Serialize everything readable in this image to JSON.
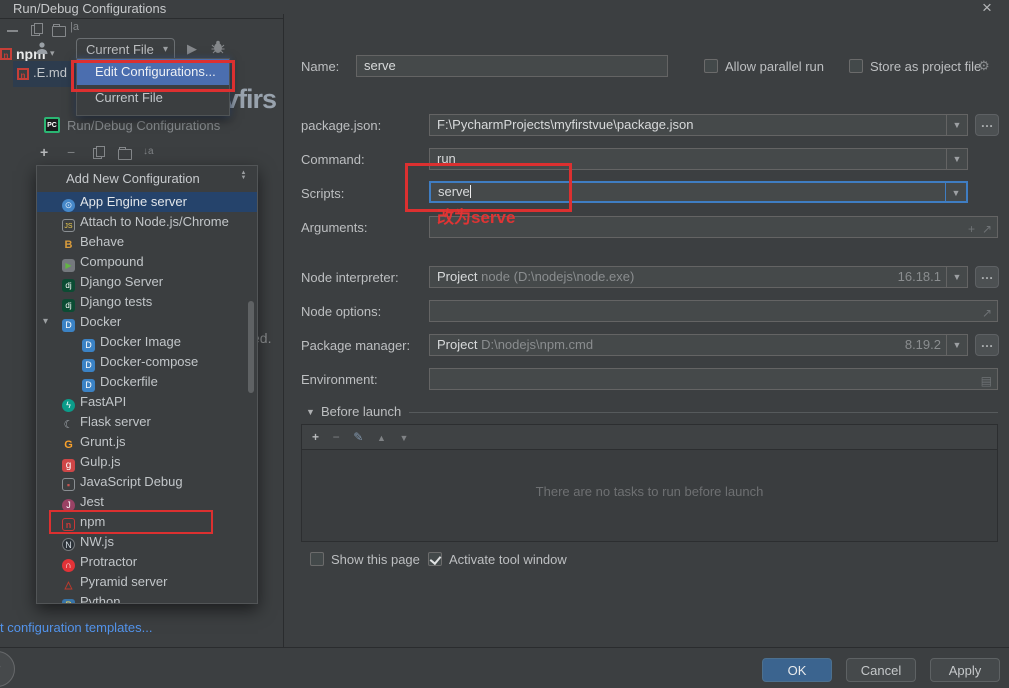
{
  "window": {
    "title": "Run/Debug Configurations",
    "close_glyph": "×"
  },
  "background": {
    "npm_item": "npm",
    "file_tab": ".E.md",
    "big_text": "vfirs",
    "ed_text": "ed.",
    "rename_icon": "|a"
  },
  "run_widget": {
    "selector_label": "Current File",
    "menu_items": [
      {
        "label": "Edit Configurations...",
        "selected": true
      },
      {
        "label": "Current File",
        "selected": false
      }
    ]
  },
  "dialog_header": {
    "pc_icon": "PC",
    "label": "Run/Debug Configurations"
  },
  "sidebar": {
    "header": "Add New Configuration",
    "templates_link": "t configuration templates...",
    "items": [
      {
        "label": "App Engine server",
        "selected": true,
        "icon": {
          "t": "⊙",
          "c": "#d5e6f7",
          "bg": "#4688c9",
          "round": true
        }
      },
      {
        "label": "Attach to Node.js/Chrome",
        "icon": {
          "t": "JS",
          "c": "#f0ce4e",
          "br": "#8a8f93",
          "fs": 7
        }
      },
      {
        "label": "Behave",
        "icon": {
          "t": "B",
          "c": "#d89b3c",
          "bold": true,
          "fs": 11
        }
      },
      {
        "label": "Compound",
        "icon": {
          "t": "▶",
          "c": "#62b543",
          "bg": "#75797e",
          "fs": 8
        }
      },
      {
        "label": "Django Server",
        "icon": {
          "t": "dj",
          "c": "#ffffff",
          "bg": "#0c4b33",
          "fs": 8
        }
      },
      {
        "label": "Django tests",
        "icon": {
          "t": "dj",
          "c": "#ffffff",
          "bg": "#0c4b33",
          "fs": 8
        }
      },
      {
        "label": "Docker",
        "chevron": true,
        "icon": {
          "t": "D",
          "c": "#ffffff",
          "bg": "#3b82c4"
        }
      },
      {
        "label": "Docker Image",
        "indent": true,
        "icon": {
          "t": "D",
          "c": "#ffffff",
          "bg": "#3b82c4"
        }
      },
      {
        "label": "Docker-compose",
        "indent": true,
        "icon": {
          "t": "D",
          "c": "#ffffff",
          "bg": "#3b82c4"
        }
      },
      {
        "label": "Dockerfile",
        "indent": true,
        "icon": {
          "t": "D",
          "c": "#ffffff",
          "bg": "#3b82c4"
        }
      },
      {
        "label": "FastAPI",
        "icon": {
          "t": "ϟ",
          "c": "#ffffff",
          "bg": "#0b9c8a",
          "round": true
        }
      },
      {
        "label": "Flask server",
        "icon": {
          "t": "☾",
          "c": "#a7adb3",
          "fs": 11
        }
      },
      {
        "label": "Grunt.js",
        "icon": {
          "t": "G",
          "c": "#f9a12c",
          "bold": true,
          "fs": 11
        }
      },
      {
        "label": "Gulp.js",
        "icon": {
          "t": "g",
          "c": "#ffffff",
          "bg": "#cf4647",
          "fs": 10
        }
      },
      {
        "label": "JavaScript Debug",
        "icon": {
          "t": "▪",
          "c": "#c75450",
          "br": "#8a8f93"
        }
      },
      {
        "label": "Jest",
        "icon": {
          "t": "J",
          "c": "#ffffff",
          "bg": "#994264",
          "round": true
        }
      },
      {
        "label": "npm",
        "boxed": true,
        "icon": {
          "t": "n",
          "c": "#cb3837",
          "br": "#cb3837",
          "bold": true
        }
      },
      {
        "label": "NW.js",
        "icon": {
          "t": "N",
          "c": "#d6dde3",
          "bg": "#2b3137",
          "br": "#777b7e",
          "round": true
        }
      },
      {
        "label": "Protractor",
        "icon": {
          "t": "∩",
          "c": "#ffffff",
          "bg": "#e23237",
          "round": true,
          "bold": true
        }
      },
      {
        "label": "Pyramid server",
        "icon": {
          "t": "△",
          "c": "#c0392b",
          "bold": true,
          "fs": 10
        }
      },
      {
        "label": "Python",
        "icon": {
          "t": "P",
          "c": "#ffd94a",
          "bg": "#3874a8"
        }
      }
    ]
  },
  "form": {
    "name": {
      "label": "Name:",
      "value": "serve"
    },
    "parallel": {
      "label": "Allow parallel run",
      "checked": false
    },
    "store": {
      "label": "Store as project file",
      "checked": false
    },
    "package_json": {
      "label": "package.json:",
      "value": "F:\\PycharmProjects\\myfirstvue\\package.json"
    },
    "command": {
      "label": "Command:",
      "value": "run"
    },
    "scripts": {
      "label": "Scripts:",
      "value": "serve"
    },
    "arguments": {
      "label": "Arguments:",
      "value": ""
    },
    "node_interpreter": {
      "label": "Node interpreter:",
      "prefix": "Project",
      "value": "node (D:\\nodejs\\node.exe)",
      "version": "16.18.1"
    },
    "node_options": {
      "label": "Node options:",
      "value": ""
    },
    "package_manager": {
      "label": "Package manager:",
      "prefix": "Project",
      "value": "D:\\nodejs\\npm.cmd",
      "version": "8.19.2"
    },
    "environment": {
      "label": "Environment:",
      "value": ""
    }
  },
  "before_launch": {
    "label": "Before launch",
    "empty_text": "There are no tasks to run before launch"
  },
  "options": {
    "show_this_page": "Show this page",
    "activate_tool_window": "Activate tool window",
    "activate_checked": true
  },
  "footer": {
    "ok": "OK",
    "cancel": "Cancel",
    "apply": "Apply",
    "help": "?"
  },
  "annotations": {
    "scripts_note": "改为serve"
  },
  "glyphs": {
    "plus": "+",
    "minus": "−",
    "pencil": "✎",
    "up": "▲",
    "down": "▼",
    "caret": "▾",
    "play": "▶",
    "dots": "…",
    "expand": "↗",
    "env": "▤",
    "gear": "⚙",
    "sort": "↓a",
    "combo": "▼",
    "collapse_up": "▲",
    "collapse_dn": "▼",
    "bug": "⚉"
  }
}
